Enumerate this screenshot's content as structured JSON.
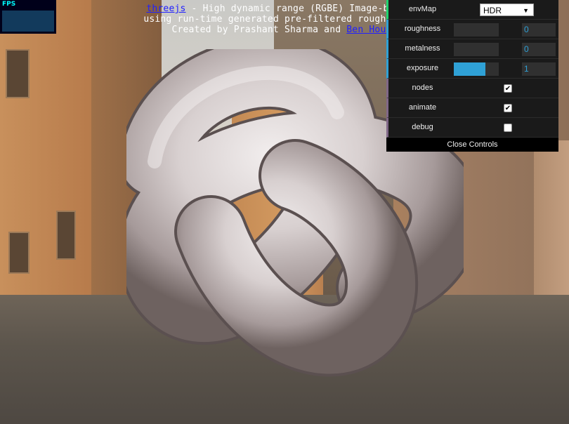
{
  "info": {
    "link1": "threejs",
    "line1_rest": " - High dynamic range (RGBE) Image-based L",
    "line2": "using run-time generated pre-filtered roughness mi",
    "line3_prefix": "Created by Prashant Sharma and ",
    "link2": "Ben Houst"
  },
  "stats": {
    "label": "FPS"
  },
  "gui": {
    "envMap": {
      "label": "envMap",
      "value": "HDR",
      "arrow": "▼"
    },
    "roughness": {
      "label": "roughness",
      "value": "0",
      "fraction": 0
    },
    "metalness": {
      "label": "metalness",
      "value": "0",
      "fraction": 0
    },
    "exposure": {
      "label": "exposure",
      "value": "1",
      "fraction": 0.7
    },
    "nodes": {
      "label": "nodes",
      "checked": "✔"
    },
    "animate": {
      "label": "animate",
      "checked": "✔"
    },
    "debug": {
      "label": "debug",
      "checked": ""
    },
    "close_label": "Close Controls"
  },
  "colors": {
    "accent": "#2fa1d6",
    "bool_accent": "#806787",
    "select_accent": "#1ed36f",
    "link": "#2020ff"
  }
}
